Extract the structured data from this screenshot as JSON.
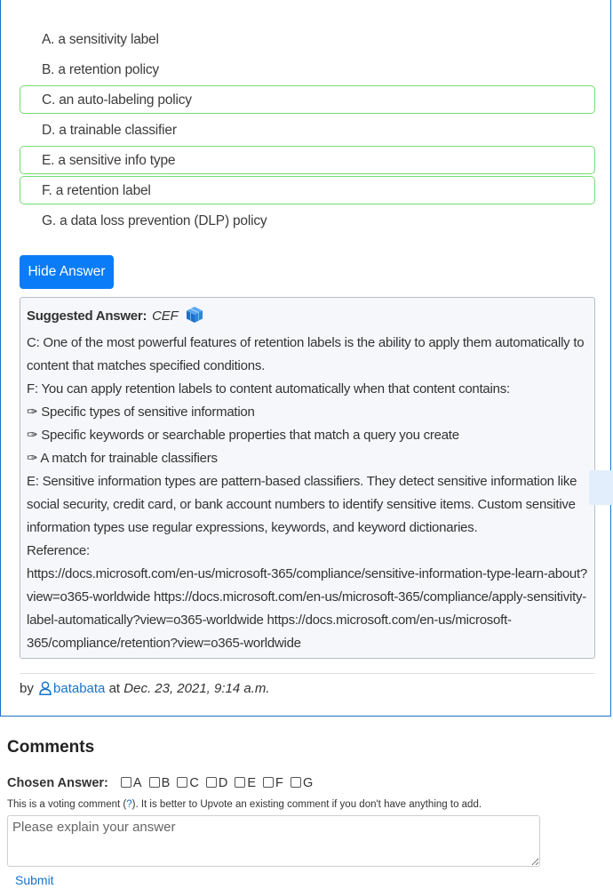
{
  "question": {
    "options": [
      {
        "text": "A. a sensitivity label",
        "correct": false
      },
      {
        "text": "B. a retention policy",
        "correct": false
      },
      {
        "text": "C. an auto-labeling policy",
        "correct": true
      },
      {
        "text": "D. a trainable classifier",
        "correct": false
      },
      {
        "text": "E. a sensitive info type",
        "correct": true
      },
      {
        "text": "F. a retention label",
        "correct": true
      },
      {
        "text": "G. a data loss prevention (DLP) policy",
        "correct": false
      }
    ],
    "hide_answer_label": "Hide Answer"
  },
  "answer": {
    "suggested_label": "Suggested Answer:",
    "suggested_value": "CEF",
    "icon": "cube-icon",
    "lines": [
      "C: One of the most powerful features of retention labels is the ability to apply them automatically to content that matches specified conditions.",
      "F: You can apply retention labels to content automatically when that content contains:",
      "✑ Specific types of sensitive information",
      "✑ Specific keywords or searchable properties that match a query you create",
      "✑ A match for trainable classifiers",
      "E: Sensitive information types are pattern-based classifiers. They detect sensitive information like social security, credit card, or bank account numbers to identify sensitive items. Custom sensitive information types use regular expressions, keywords, and keyword dictionaries.",
      "Reference:",
      "https://docs.microsoft.com/en-us/microsoft-365/compliance/sensitive-information-type-learn-about?view=o365-worldwide https://docs.microsoft.com/en-us/microsoft-365/compliance/apply-sensitivity-label-automatically?view=o365-worldwide https://docs.microsoft.com/en-us/microsoft-365/compliance/retention?view=o365-worldwide"
    ]
  },
  "byline": {
    "by": "by",
    "user": "batabata",
    "at": "at",
    "date": "Dec. 23, 2021, 9:14 a.m."
  },
  "comments": {
    "title": "Comments",
    "chosen_label": "Chosen Answer:",
    "choices": [
      "A",
      "B",
      "C",
      "D",
      "E",
      "F",
      "G"
    ],
    "vote_note_before": "This is a voting comment (",
    "vote_note_link": "?",
    "vote_note_after": "). It is better to Upvote an existing comment if you don't have anything to add.",
    "placeholder": "Please explain your answer",
    "submit_label": "Submit"
  },
  "colors": {
    "primary": "#0a7cf7",
    "correct_border": "#76dd76",
    "link": "#1a73c9"
  }
}
